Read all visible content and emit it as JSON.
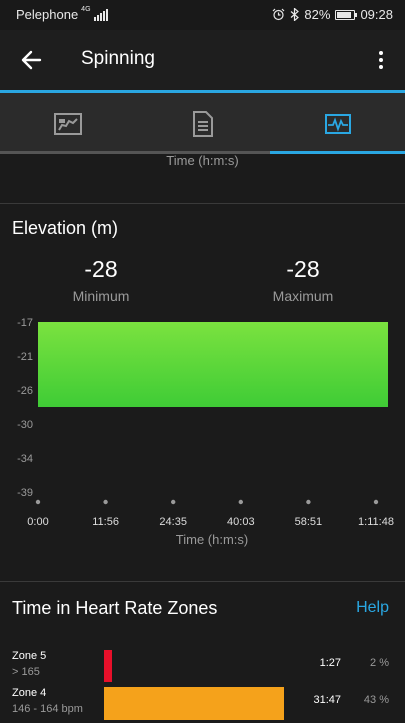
{
  "status_bar": {
    "carrier": "Pelephone",
    "network_type": "4G",
    "battery_percent": "82%",
    "battery_level": 0.82,
    "time": "09:28"
  },
  "app_bar": {
    "title": "Spinning"
  },
  "tabs": [
    {
      "icon": "summary-map-icon",
      "active": false
    },
    {
      "icon": "details-document-icon",
      "active": false
    },
    {
      "icon": "charts-icon",
      "active": true
    }
  ],
  "previous_chart": {
    "x_label": "Time (h:m:s)"
  },
  "elevation": {
    "title": "Elevation (m)",
    "minimum_value": "-28",
    "minimum_label": "Minimum",
    "maximum_value": "-28",
    "maximum_label": "Maximum"
  },
  "chart_data": {
    "type": "area",
    "title": "Elevation (m)",
    "xlabel": "Time (h:m:s)",
    "ylabel": "",
    "x_tick_labels": [
      "0:00",
      "11:56",
      "24:35",
      "40:03",
      "58:51",
      "1:11:48"
    ],
    "y_tick_labels": [
      "-17",
      "-21",
      "-26",
      "-30",
      "-34",
      "-39"
    ],
    "ylim": [
      -39,
      -17
    ],
    "baseline": -28,
    "series": [
      {
        "x": [
          "0:00",
          "1:11:48"
        ],
        "values": [
          -17,
          -17
        ]
      }
    ],
    "fill_gradient": [
      "#7be23f",
      "#3fcc36"
    ],
    "grid": false
  },
  "heart_rate_zones": {
    "title": "Time in Heart Rate Zones",
    "help_label": "Help",
    "zones": [
      {
        "name": "Zone 5",
        "range": "> 165",
        "time": "1:27",
        "percent": "2 %",
        "fraction": 0.02,
        "color": "#e8102a"
      },
      {
        "name": "Zone 4",
        "range": "146 - 164 bpm",
        "time": "31:47",
        "percent": "43 %",
        "fraction": 0.43,
        "color": "#f5a21b"
      }
    ]
  }
}
